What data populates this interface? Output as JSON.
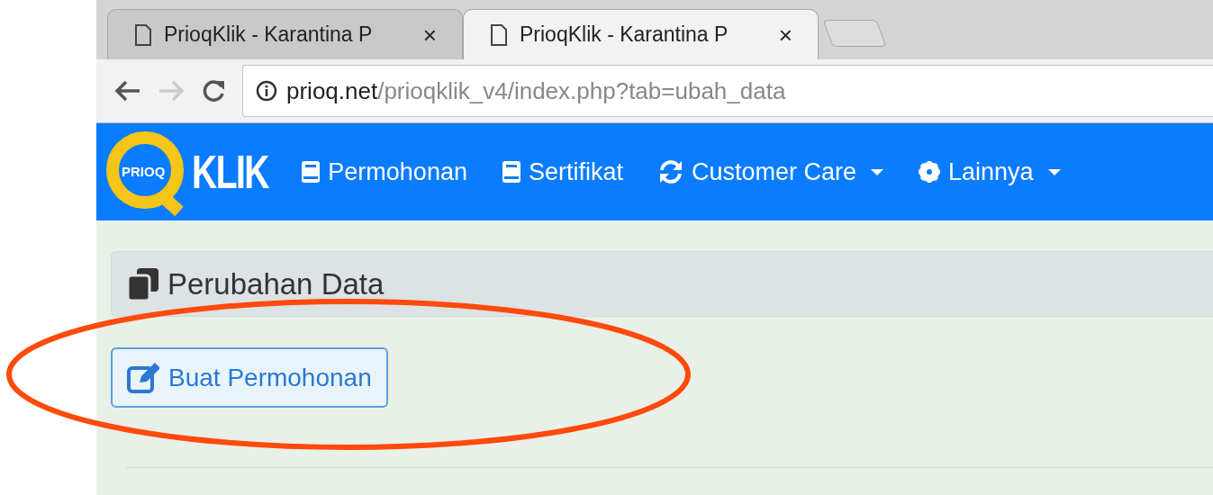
{
  "browser": {
    "tabs": [
      {
        "title": "PrioqKlik - Karantina P",
        "close": "×",
        "selected": false
      },
      {
        "title": "PrioqKlik - Karantina P",
        "close": "×",
        "selected": true
      }
    ],
    "address": {
      "domain": "prioq.net",
      "path": "/prioqklik_v4/index.php?tab=ubah_data"
    }
  },
  "navbar": {
    "logo": {
      "badge": "PRIOQ",
      "wordmark": "KLIK"
    },
    "items": [
      {
        "label": "Permohonan",
        "kind": "book",
        "dropdown": false
      },
      {
        "label": "Sertifikat",
        "kind": "book",
        "dropdown": false
      },
      {
        "label": "Customer Care",
        "kind": "sync",
        "dropdown": true
      },
      {
        "label": "Lainnya",
        "kind": "gear",
        "dropdown": true
      }
    ]
  },
  "page": {
    "heading": "Perubahan Data",
    "button": "Buat Permohonan"
  },
  "annotation": {
    "kind": "ellipse"
  }
}
